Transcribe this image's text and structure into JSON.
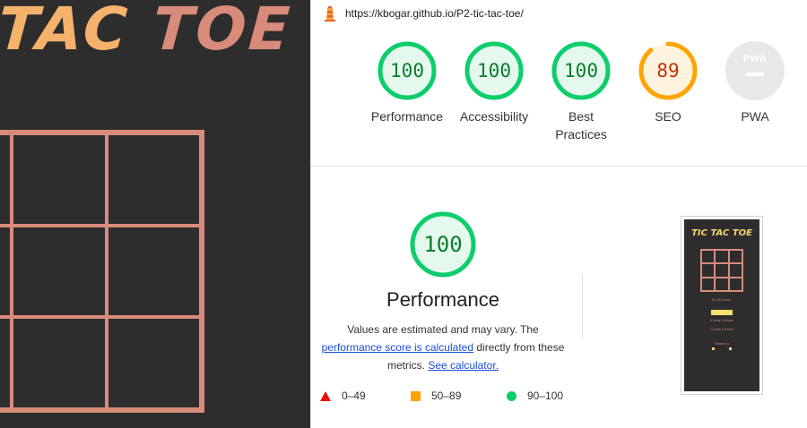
{
  "game": {
    "title_word1": "TAC",
    "title_word2": "TOE",
    "colors": {
      "background": "#2d2d2d",
      "accent": "#d98b7a",
      "title": "#f4b26b"
    }
  },
  "browser": {
    "url": "https://kbogar.github.io/P2-tic-tac-toe/",
    "icon": "lighthouse-icon"
  },
  "scores": [
    {
      "value": "100",
      "label": "Performance",
      "score": 100,
      "color": "#0cce6b"
    },
    {
      "value": "100",
      "label": "Accessibility",
      "score": 100,
      "color": "#0cce6b"
    },
    {
      "value": "100",
      "label": "Best Practices",
      "score": 100,
      "color": "#0cce6b"
    },
    {
      "value": "89",
      "label": "SEO",
      "score": 89,
      "color": "#ffa400"
    },
    {
      "value": "PWA",
      "label": "PWA",
      "score": null,
      "color": "#e0e0e0"
    }
  ],
  "performance": {
    "score": "100",
    "title": "Performance",
    "desc_part1": "Values are estimated and may vary. The",
    "desc_link1": "performance score is calculated",
    "desc_part2": "directly from these",
    "desc_part3": "metrics.",
    "desc_link2": "See calculator."
  },
  "legend": [
    {
      "range": "0–49",
      "shape": "triangle",
      "color": "#eb0f00"
    },
    {
      "range": "50–89",
      "shape": "square",
      "color": "#ffa400"
    },
    {
      "range": "90–100",
      "shape": "circle",
      "color": "#0cce6b"
    }
  ],
  "thumbnail": {
    "title": "TIC TAC TOE",
    "status": "It's X's turn!",
    "restart": "Restart",
    "score_x": "X wins 0 times",
    "score_o": "O wins 0 times",
    "follow": "Follow us"
  }
}
